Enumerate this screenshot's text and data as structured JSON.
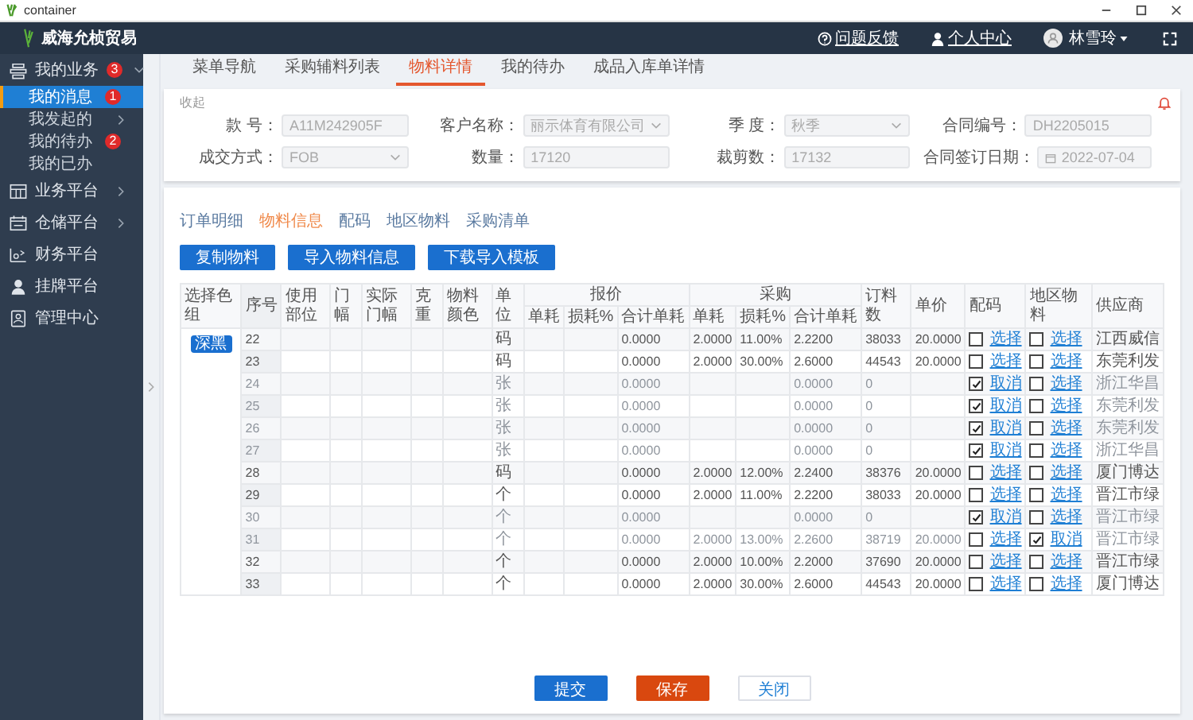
{
  "window": {
    "title": "container"
  },
  "topbar": {
    "brand": "威海允桢贸易",
    "links": [
      "问题反馈",
      "个人中心"
    ],
    "user": "林雪玲"
  },
  "sidebar": {
    "items": [
      {
        "label": "我的业务",
        "badge": "3",
        "expanded": true,
        "children": [
          {
            "label": "我的消息",
            "selected": true,
            "badge": "1"
          },
          {
            "label": "我发起的",
            "selected": false,
            "expanded": false
          },
          {
            "label": "我的待办",
            "selected": false,
            "badge": "2"
          },
          {
            "label": "我的已办",
            "selected": false
          }
        ]
      },
      {
        "label": "业务平台",
        "expanded": false
      },
      {
        "label": "仓储平台",
        "expanded": false
      },
      {
        "label": "财务平台"
      },
      {
        "label": "挂牌平台"
      },
      {
        "label": "管理中心"
      }
    ]
  },
  "tabs": [
    {
      "label": "菜单导航",
      "selected": false
    },
    {
      "label": "采购辅料列表",
      "selected": false
    },
    {
      "label": "物料详情",
      "selected": true
    },
    {
      "label": "我的待办",
      "selected": false
    },
    {
      "label": "成品入库单详情",
      "selected": false
    }
  ],
  "form": {
    "collapse": "收起",
    "fields": [
      {
        "kind": "text",
        "label": "款 号：",
        "value": "A11M242905F"
      },
      {
        "kind": "select",
        "label": "客户名称：",
        "value": "丽示体育有限公司"
      },
      {
        "kind": "select",
        "label": "季 度：",
        "value": "秋季"
      },
      {
        "kind": "text",
        "label": "合同编号：",
        "value": "DH2205015"
      },
      {
        "kind": "select",
        "label": "成交方式：",
        "value": "FOB"
      },
      {
        "kind": "text",
        "label": "数量：",
        "value": "17120"
      },
      {
        "kind": "text",
        "label": "裁剪数：",
        "value": "17132"
      },
      {
        "kind": "date",
        "label": "合同签订日期：",
        "value": "2022-07-04"
      }
    ]
  },
  "subtabs": [
    {
      "label": "订单明细",
      "selected": false
    },
    {
      "label": "物料信息",
      "selected": true
    },
    {
      "label": "配码",
      "selected": false
    },
    {
      "label": "地区物料",
      "selected": false
    },
    {
      "label": "采购清单",
      "selected": false
    }
  ],
  "actions": [
    "复制物料",
    "导入物料信息",
    "下载导入模板"
  ],
  "table": {
    "columns": [
      {
        "label": "选择色组"
      },
      {
        "label": "序号"
      },
      {
        "label": "使用部位"
      },
      {
        "label": "门幅"
      },
      {
        "label": "实际门幅"
      },
      {
        "label": "克重"
      },
      {
        "label": "物料颜色"
      },
      {
        "label": "单位"
      },
      {
        "label": "报价",
        "children": [
          "单耗",
          "损耗%",
          "合计单耗"
        ]
      },
      {
        "label": "采购",
        "children": [
          "单耗",
          "损耗%",
          "合计单耗"
        ]
      },
      {
        "label": "订料数"
      },
      {
        "label": "单价"
      },
      {
        "label": "配码"
      },
      {
        "label": "地区物料"
      },
      {
        "label": "供应商"
      }
    ],
    "color_group": "深黑",
    "rows": [
      {
        "no": "22",
        "disabled": false,
        "unit": "码",
        "bj_total": "0.0000",
        "cg_unit": "2.0000",
        "cg_loss": "11.00%",
        "cg_total": "2.2200",
        "qty": "38033",
        "price": "20.0000",
        "match": {
          "checked": false,
          "link": "选择"
        },
        "region": {
          "checked": false,
          "link": "选择"
        },
        "supplier": "江西威信"
      },
      {
        "no": "23",
        "disabled": false,
        "unit": "码",
        "bj_total": "0.0000",
        "cg_unit": "2.0000",
        "cg_loss": "30.00%",
        "cg_total": "2.6000",
        "qty": "44543",
        "price": "20.0000",
        "match": {
          "checked": false,
          "link": "选择"
        },
        "region": {
          "checked": false,
          "link": "选择"
        },
        "supplier": "东莞利发"
      },
      {
        "no": "24",
        "disabled": true,
        "unit": "张",
        "bj_total": "0.0000",
        "cg_total": "0.0000",
        "qty": "0",
        "match": {
          "checked": true,
          "link": "取消"
        },
        "region": {
          "checked": false,
          "link": "选择"
        },
        "supplier": "浙江华昌"
      },
      {
        "no": "25",
        "disabled": true,
        "unit": "张",
        "bj_total": "0.0000",
        "cg_total": "0.0000",
        "qty": "0",
        "match": {
          "checked": true,
          "link": "取消"
        },
        "region": {
          "checked": false,
          "link": "选择"
        },
        "supplier": "东莞利发"
      },
      {
        "no": "26",
        "disabled": true,
        "unit": "张",
        "bj_total": "0.0000",
        "cg_total": "0.0000",
        "qty": "0",
        "match": {
          "checked": true,
          "link": "取消"
        },
        "region": {
          "checked": false,
          "link": "选择"
        },
        "supplier": "东莞利发"
      },
      {
        "no": "27",
        "disabled": true,
        "unit": "张",
        "bj_total": "0.0000",
        "cg_total": "0.0000",
        "qty": "0",
        "match": {
          "checked": true,
          "link": "取消"
        },
        "region": {
          "checked": false,
          "link": "选择"
        },
        "supplier": "浙江华昌"
      },
      {
        "no": "28",
        "disabled": false,
        "unit": "码",
        "bj_total": "0.0000",
        "cg_unit": "2.0000",
        "cg_loss": "12.00%",
        "cg_total": "2.2400",
        "qty": "38376",
        "price": "20.0000",
        "match": {
          "checked": false,
          "link": "选择"
        },
        "region": {
          "checked": false,
          "link": "选择"
        },
        "supplier": "厦门博达"
      },
      {
        "no": "29",
        "disabled": false,
        "unit": "个",
        "bj_total": "0.0000",
        "cg_unit": "2.0000",
        "cg_loss": "11.00%",
        "cg_total": "2.2200",
        "qty": "38033",
        "price": "20.0000",
        "match": {
          "checked": false,
          "link": "选择"
        },
        "region": {
          "checked": false,
          "link": "选择"
        },
        "supplier": "晋江市绿"
      },
      {
        "no": "30",
        "disabled": true,
        "unit": "个",
        "bj_total": "0.0000",
        "cg_total": "0.0000",
        "qty": "0",
        "match": {
          "checked": true,
          "link": "取消"
        },
        "region": {
          "checked": false,
          "link": "选择"
        },
        "supplier": "晋江市绿"
      },
      {
        "no": "31",
        "disabled": true,
        "unit": "个",
        "bj_total": "0.0000",
        "cg_unit": "2.0000",
        "cg_loss": "13.00%",
        "cg_total": "2.2600",
        "qty": "38719",
        "price": "20.0000",
        "match": {
          "checked": false,
          "link": "选择"
        },
        "region": {
          "checked": true,
          "link": "取消"
        },
        "supplier": "晋江市绿"
      },
      {
        "no": "32",
        "disabled": false,
        "unit": "个",
        "bj_total": "0.0000",
        "cg_unit": "2.0000",
        "cg_loss": "10.00%",
        "cg_total": "2.2000",
        "qty": "37690",
        "price": "20.0000",
        "match": {
          "checked": false,
          "link": "选择"
        },
        "region": {
          "checked": false,
          "link": "选择"
        },
        "supplier": "晋江市绿"
      },
      {
        "no": "33",
        "disabled": false,
        "unit": "个",
        "bj_total": "0.0000",
        "cg_unit": "2.0000",
        "cg_loss": "30.00%",
        "cg_total": "2.6000",
        "qty": "44543",
        "price": "20.0000",
        "match": {
          "checked": false,
          "link": "选择"
        },
        "region": {
          "checked": false,
          "link": "选择"
        },
        "supplier": "厦门博达"
      }
    ]
  },
  "footer": [
    {
      "kind": "primary",
      "label": "提交"
    },
    {
      "kind": "danger",
      "label": "保存"
    },
    {
      "kind": "default",
      "label": "关闭"
    }
  ]
}
